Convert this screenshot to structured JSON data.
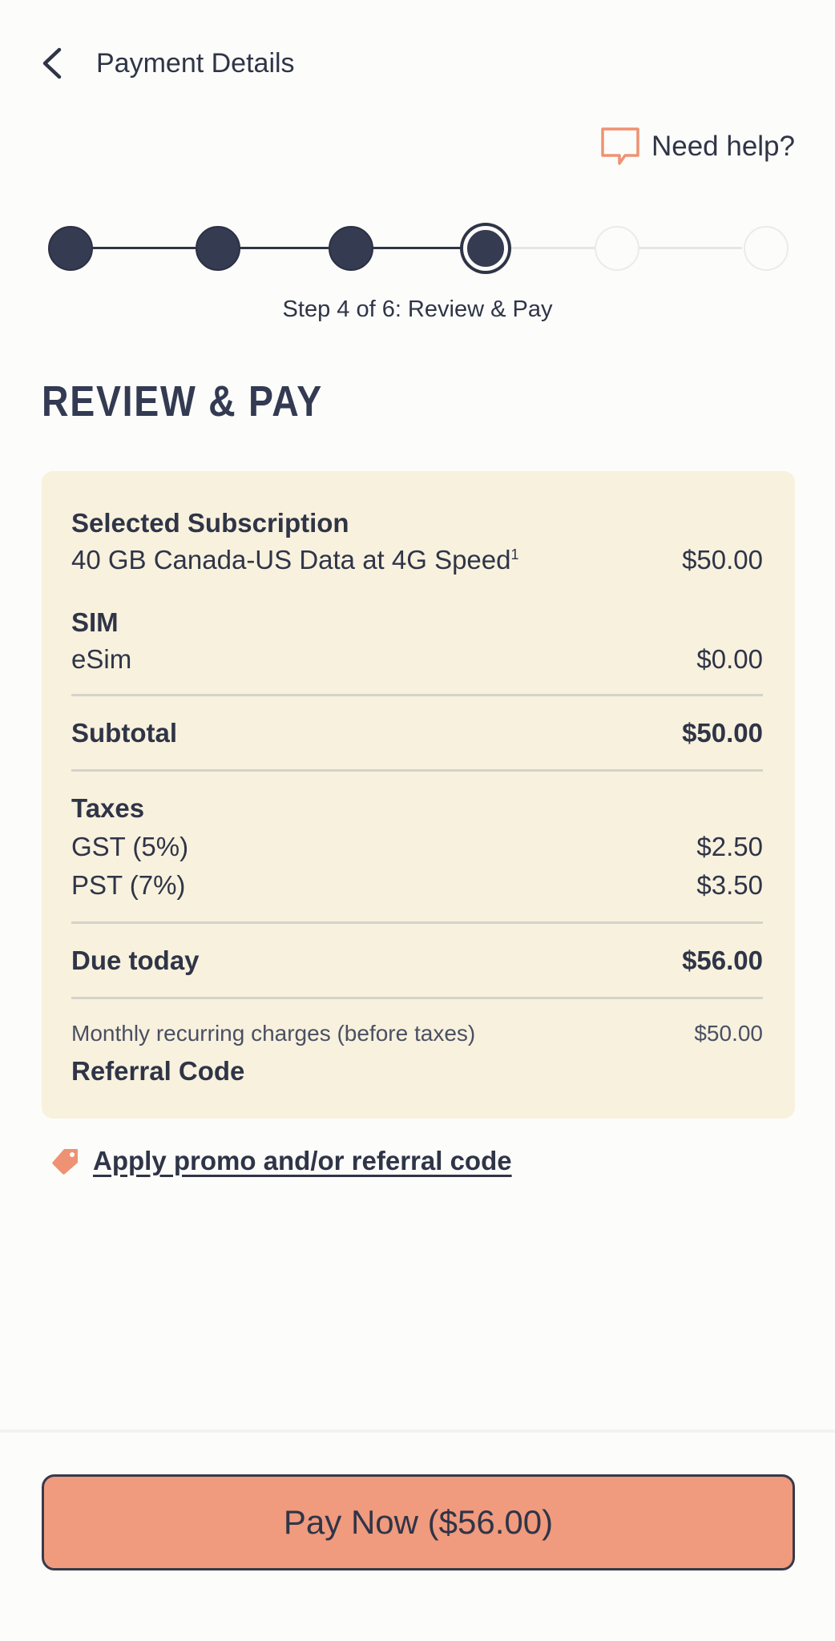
{
  "header": {
    "title": "Payment Details",
    "help_label": "Need help?"
  },
  "stepper": {
    "caption": "Step 4 of 6: Review & Pay",
    "steps": [
      {
        "state": "complete"
      },
      {
        "state": "complete"
      },
      {
        "state": "complete"
      },
      {
        "state": "current"
      },
      {
        "state": "upcoming"
      },
      {
        "state": "upcoming"
      }
    ]
  },
  "page_title": "REVIEW & PAY",
  "summary": {
    "subscription_heading": "Selected Subscription",
    "subscription_name": "40 GB Canada-US Data at 4G Speed",
    "subscription_footnote": "1",
    "subscription_price": "$50.00",
    "sim_heading": "SIM",
    "sim_type": "eSim",
    "sim_price": "$0.00",
    "subtotal_label": "Subtotal",
    "subtotal_value": "$50.00",
    "taxes_heading": "Taxes",
    "gst_label": "GST (5%)",
    "gst_value": "$2.50",
    "pst_label": "PST (7%)",
    "pst_value": "$3.50",
    "due_label": "Due today",
    "due_value": "$56.00",
    "monthly_label": "Monthly recurring charges (before taxes)",
    "monthly_value": "$50.00",
    "referral_heading": "Referral Code"
  },
  "promo": {
    "label": "Apply promo and/or referral code"
  },
  "pay_button": {
    "label": "Pay Now ($56.00)"
  },
  "colors": {
    "primary_dark": "#2f3547",
    "accent_coral": "#f09a7e",
    "card_bg": "#f8f1de",
    "page_bg": "#fcfcfa"
  }
}
